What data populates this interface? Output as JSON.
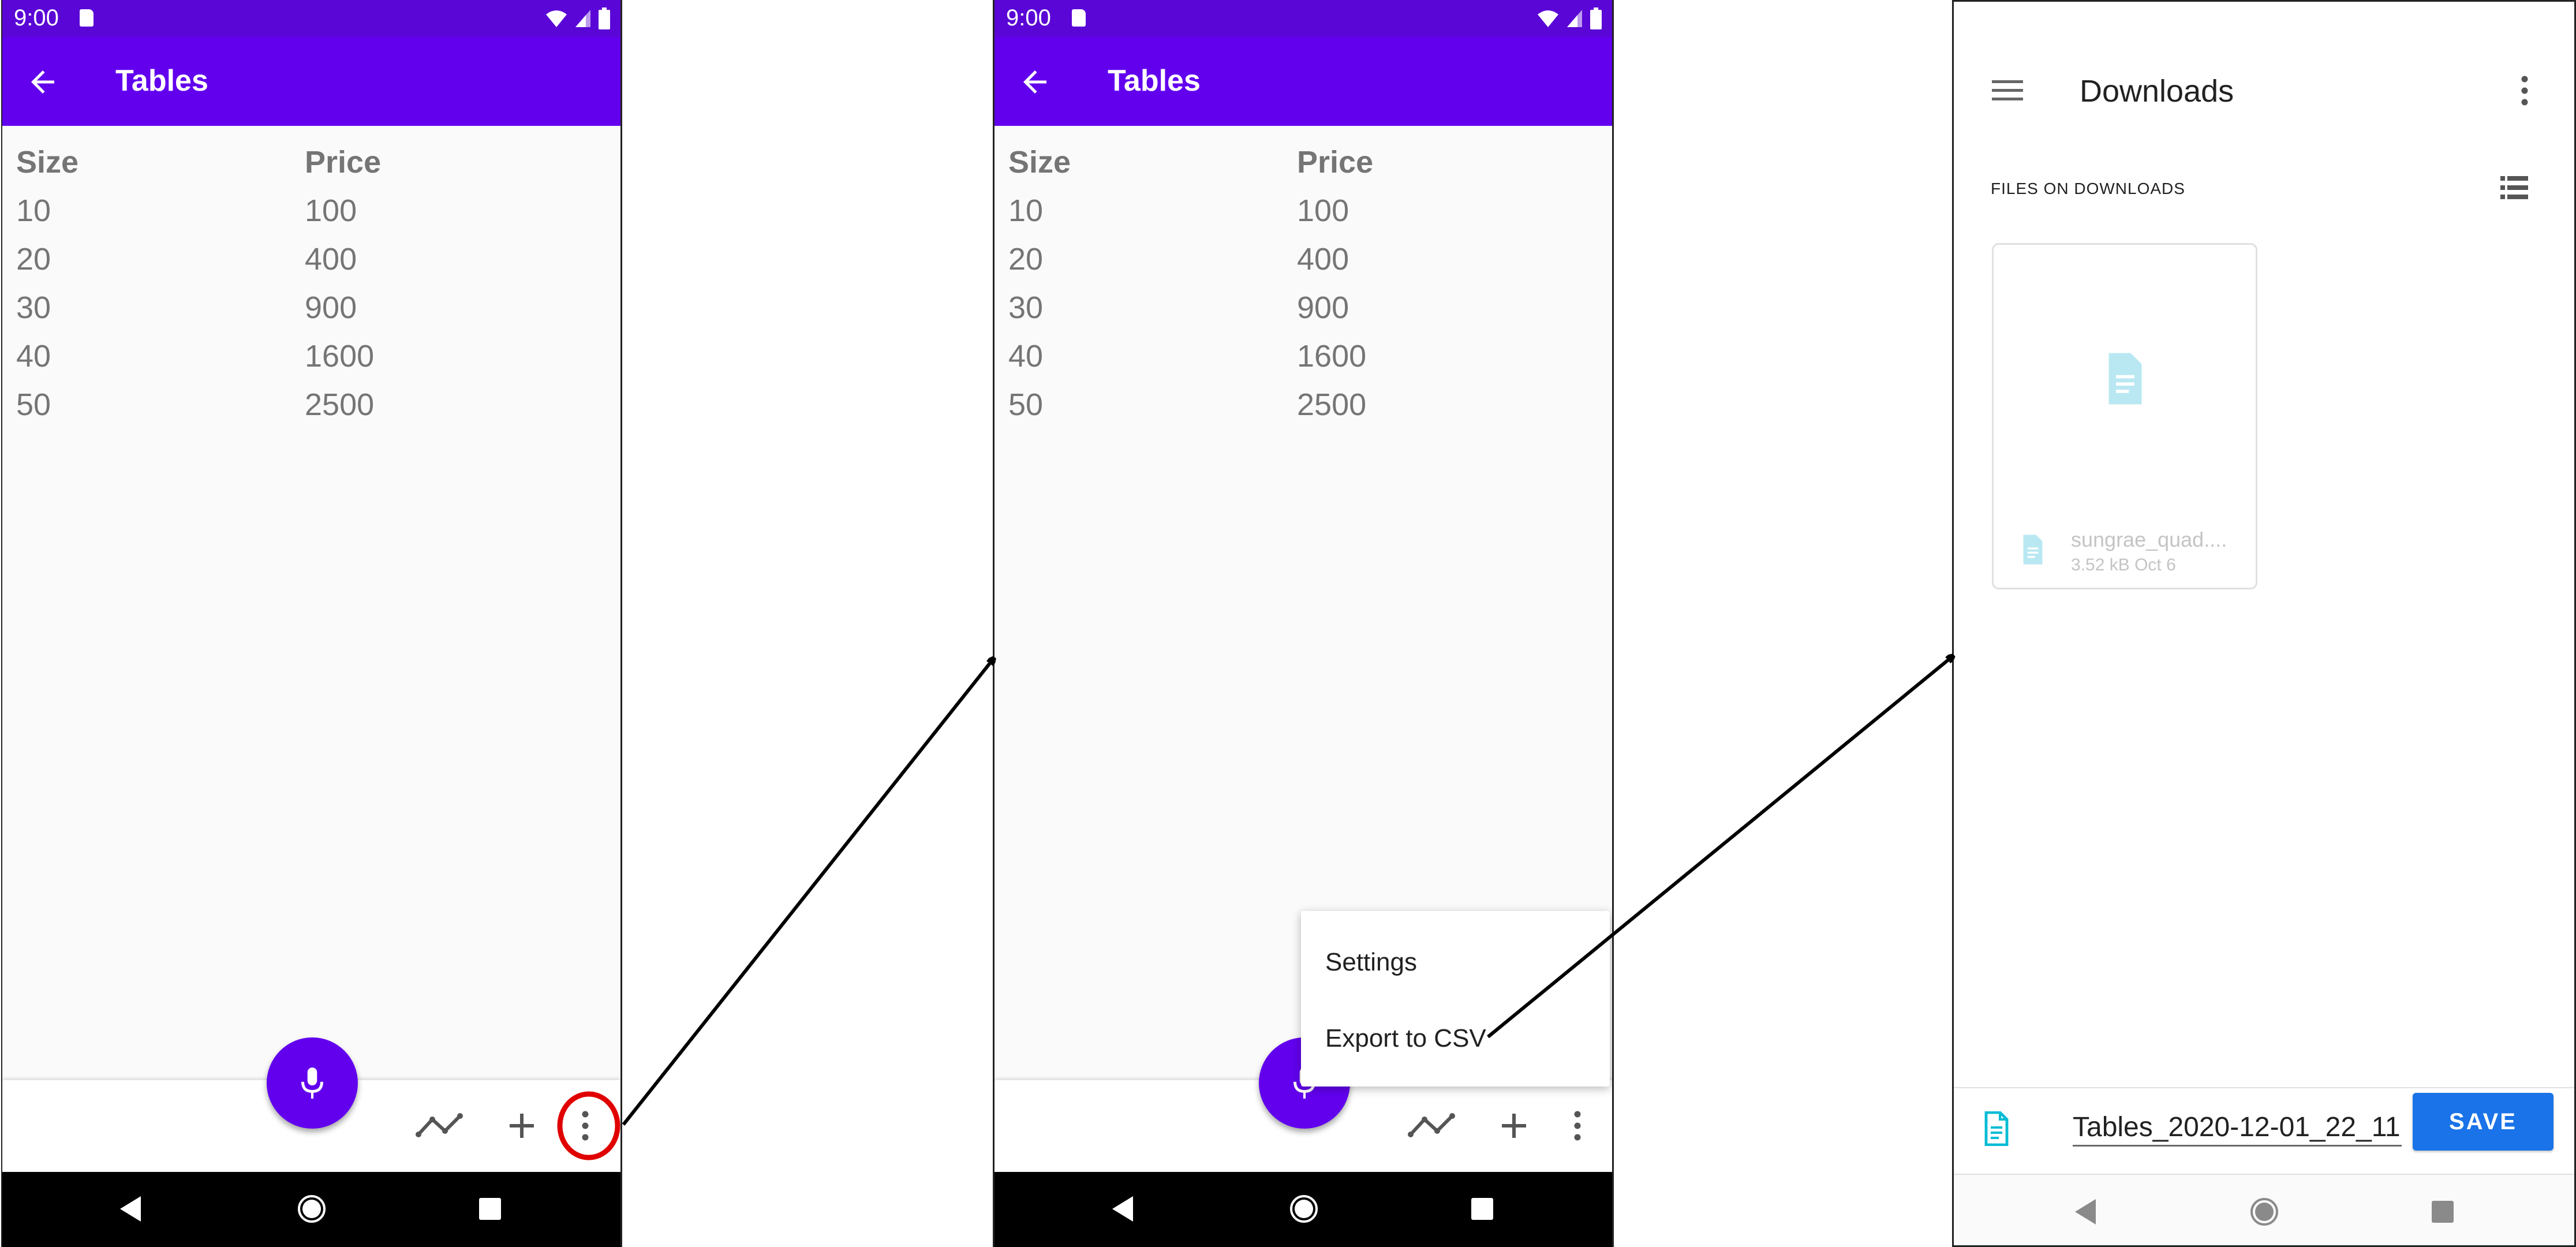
{
  "status": {
    "time": "9:00"
  },
  "tables_screen": {
    "title": "Tables",
    "columns": [
      "Size",
      "Price"
    ],
    "rows": [
      [
        "10",
        "100"
      ],
      [
        "20",
        "400"
      ],
      [
        "30",
        "900"
      ],
      [
        "40",
        "1600"
      ],
      [
        "50",
        "2500"
      ]
    ]
  },
  "overflow_menu": {
    "items": [
      "Settings",
      "Export to CSV"
    ]
  },
  "downloads_screen": {
    "title": "Downloads",
    "section": "FILES ON DOWNLOADS",
    "file": {
      "name": "sungrae_quad....",
      "size": "3.52 kB",
      "date": "Oct 6"
    },
    "filename_value": "Tables_2020-12-01_22_11",
    "save_label": "SAVE"
  },
  "icons": [
    "back-arrow-icon",
    "mic-icon",
    "chart-icon",
    "add-icon",
    "more-vert-icon",
    "menu-icon",
    "list-view-icon",
    "document-icon",
    "sd-card-icon",
    "wifi-icon",
    "signal-icon",
    "battery-icon"
  ],
  "colors": {
    "primary": "#6200ee",
    "status": "#5a06d6",
    "accent": "#1a73e8",
    "highlight_circle": "#e00000",
    "doc_icon": "#00bcd4"
  }
}
